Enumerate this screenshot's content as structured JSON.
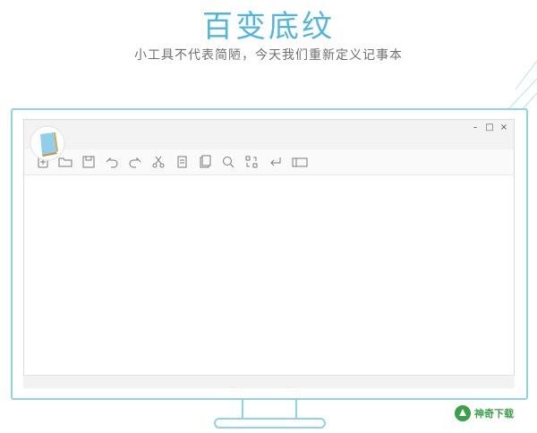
{
  "hero": {
    "title": "百变底纹",
    "subtitle": "小工具不代表简陋，今天我们重新定义记事本"
  },
  "window": {
    "controls": [
      {
        "name": "minimize",
        "symbol": "–"
      },
      {
        "name": "maximize",
        "symbol": "□"
      },
      {
        "name": "close",
        "symbol": "×"
      }
    ]
  },
  "toolbar": {
    "items": [
      "new",
      "open",
      "save",
      "undo",
      "redo",
      "cut",
      "copy",
      "paste",
      "find",
      "replace",
      "goto",
      "theme"
    ]
  },
  "watermark": {
    "text": "神奇下载"
  },
  "colors": {
    "accent": "#4fb6e0",
    "frame": "#8fd2ee",
    "watermark": "#3aa14a"
  }
}
